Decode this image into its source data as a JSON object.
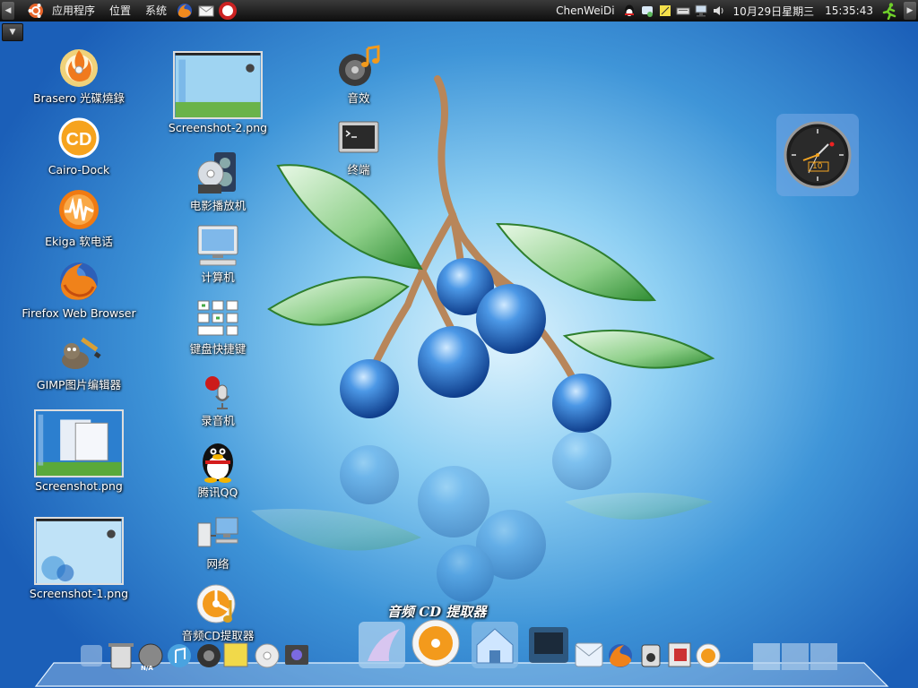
{
  "top_panel": {
    "menus": [
      "应用程序",
      "位置",
      "系统"
    ],
    "username": "ChenWeiDi",
    "date": "10月29日星期三",
    "time": "15:35:43"
  },
  "desktop_icons_left": [
    {
      "name": "brasero",
      "label": "Brasero 光碟燒錄",
      "icon": "disc-burner-icon"
    },
    {
      "name": "cairo-dock",
      "label": "Cairo-Dock",
      "icon": "cairo-dock-icon"
    },
    {
      "name": "ekiga",
      "label": "Ekiga 软电话",
      "icon": "softphone-icon"
    },
    {
      "name": "firefox",
      "label": "Firefox Web Browser",
      "icon": "firefox-icon"
    },
    {
      "name": "gimp",
      "label": "GIMP图片编辑器",
      "icon": "gimp-icon"
    },
    {
      "name": "screenshot",
      "label": "Screenshot.png",
      "icon": "image-thumbnail"
    },
    {
      "name": "screenshot-1",
      "label": "Screenshot-1.png",
      "icon": "image-thumbnail"
    }
  ],
  "desktop_icons_middle": [
    {
      "name": "screenshot-2",
      "label": "Screenshot-2.png",
      "icon": "image-thumbnail"
    },
    {
      "name": "movie-player",
      "label": "电影播放机",
      "icon": "movie-player-icon"
    },
    {
      "name": "computer",
      "label": "计算机",
      "icon": "computer-icon"
    },
    {
      "name": "keyboard-shortcuts",
      "label": "键盘快捷键",
      "icon": "keyboard-icon"
    },
    {
      "name": "sound-recorder",
      "label": "录音机",
      "icon": "microphone-icon"
    },
    {
      "name": "qq",
      "label": "腾讯QQ",
      "icon": "penguin-icon"
    },
    {
      "name": "network",
      "label": "网络",
      "icon": "network-icon"
    },
    {
      "name": "cd-ripper",
      "label": "音频CD提取器",
      "icon": "cd-ripper-icon"
    }
  ],
  "desktop_icons_right": [
    {
      "name": "sound",
      "label": "音效",
      "icon": "speaker-icon"
    },
    {
      "name": "terminal",
      "label": "终端",
      "icon": "terminal-icon"
    }
  ],
  "clock_widget": {
    "date_text": "10"
  },
  "dock": {
    "hover_title": "音频 CD 提取器",
    "weather_badge": "N/A"
  },
  "colors": {
    "panel": "#1a1a1a",
    "wallpaper_dark": "#1b5fb8",
    "wallpaper_light": "#dff3fd",
    "berry": "#2f74c8",
    "leaf": "#4cae48"
  }
}
